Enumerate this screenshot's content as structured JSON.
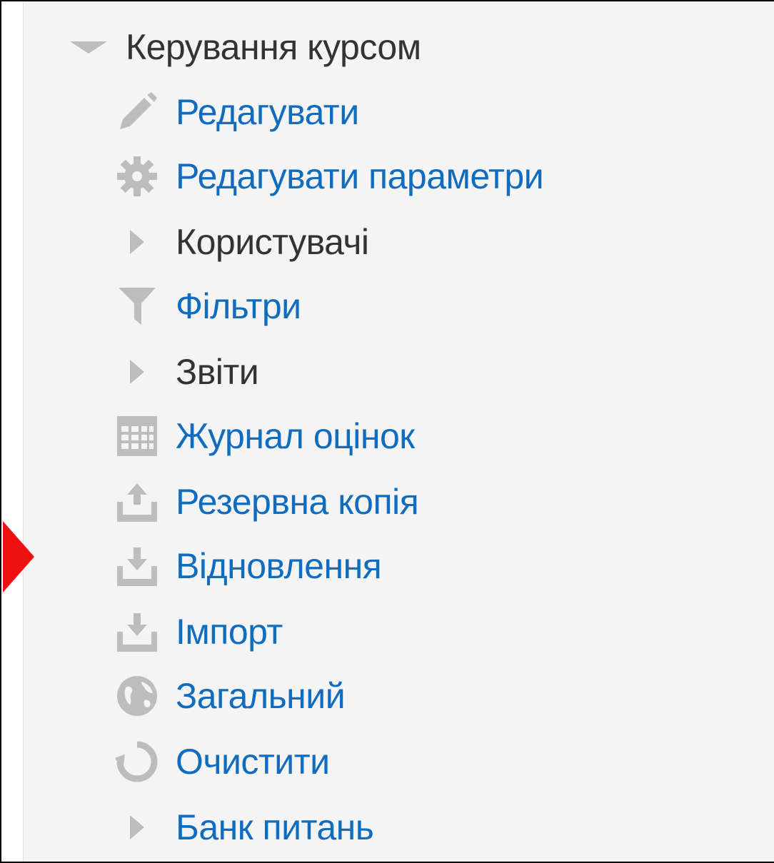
{
  "nav": {
    "header": {
      "label": "Керування курсом",
      "icon": "caret-down-icon"
    },
    "items": [
      {
        "label": "Редагувати",
        "icon": "pencil-icon",
        "type": "link"
      },
      {
        "label": "Редагувати параметри",
        "icon": "gear-icon",
        "type": "link"
      },
      {
        "label": "Користувачі",
        "icon": "caret-right-icon",
        "type": "branch"
      },
      {
        "label": "Фільтри",
        "icon": "filter-icon",
        "type": "link"
      },
      {
        "label": "Звіти",
        "icon": "caret-right-icon",
        "type": "branch"
      },
      {
        "label": "Журнал оцінок",
        "icon": "table-icon",
        "type": "link"
      },
      {
        "label": "Резервна копія",
        "icon": "upload-icon",
        "type": "link"
      },
      {
        "label": "Відновлення",
        "icon": "download-icon",
        "type": "link"
      },
      {
        "label": "Імпорт",
        "icon": "download-icon",
        "type": "link"
      },
      {
        "label": "Загальний",
        "icon": "globe-icon",
        "type": "link"
      },
      {
        "label": "Очистити",
        "icon": "refresh-icon",
        "type": "link"
      },
      {
        "label": "Банк питань",
        "icon": "caret-right-icon",
        "type": "branch-link"
      }
    ]
  },
  "colors": {
    "link": "#0f6cbf",
    "text": "#333333",
    "icon": "#bdbdbd",
    "panel_bg": "#f4f4f4",
    "pointer": "#ee1111"
  }
}
